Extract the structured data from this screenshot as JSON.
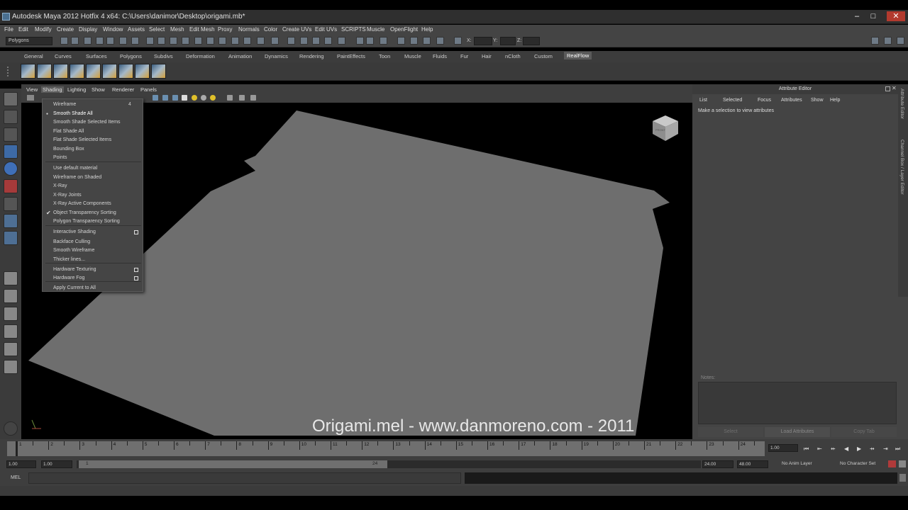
{
  "window": {
    "title": "Autodesk Maya 2012 Hotfix 4 x64: C:\\Users\\danimor\\Desktop\\origami.mb*"
  },
  "menubar": [
    "File",
    "Edit",
    "Modify",
    "Create",
    "Display",
    "Window",
    "Assets",
    "Select",
    "Mesh",
    "Edit Mesh",
    "Proxy",
    "Normals",
    "Color",
    "Create UVs",
    "Edit UVs",
    "SCRIPTS",
    "Muscle",
    "OpenFlight",
    "Help"
  ],
  "statusline": {
    "mode": "Polygons",
    "coord_labels": [
      "X:",
      "Y:",
      "Z:"
    ]
  },
  "shelf_tabs": [
    "General",
    "Curves",
    "Surfaces",
    "Polygons",
    "Subdivs",
    "Deformation",
    "Animation",
    "Dynamics",
    "Rendering",
    "PaintEffects",
    "Toon",
    "Muscle",
    "Fluids",
    "Fur",
    "Hair",
    "nCloth",
    "Custom",
    "RealFlow"
  ],
  "shelf_active": "RealFlow",
  "panel_menu": [
    "View",
    "Shading",
    "Lighting",
    "Show",
    "Renderer",
    "Panels"
  ],
  "shading_menu": {
    "items": [
      "Wireframe",
      "Smooth Shade All",
      "Smooth Shade Selected Items",
      "Flat Shade All",
      "Flat Shade Selected Items",
      "Bounding Box",
      "Points",
      "Use default material",
      "Wireframe on Shaded",
      "X-Ray",
      "X-Ray Joints",
      "X-Ray Active Components",
      "Object Transparency Sorting",
      "Polygon Transparency Sorting",
      "Interactive Shading",
      "Backface Culling",
      "Smooth Wireframe",
      "Thicker lines...",
      "Hardware Texturing",
      "Hardware Fog",
      "Apply Current to All"
    ],
    "wireframe_hotkey": "4",
    "selected_radio": "Smooth Shade All",
    "checked": "Object Transparency Sorting",
    "option_box_items": [
      "Interactive Shading",
      "Hardware Texturing",
      "Hardware Fog"
    ]
  },
  "viewport": {
    "watermark": "Origami.mel - www.danmoreno.com - 2011",
    "viewcube_label": "FRONT"
  },
  "attribute_editor": {
    "title": "Attribute Editor",
    "menu": [
      "List",
      "Selected",
      "Focus",
      "Attributes",
      "Show",
      "Help"
    ],
    "message": "Make a selection to view attributes",
    "notes_label": "Notes:",
    "buttons": [
      "Select",
      "Load Attributes",
      "Copy Tab"
    ]
  },
  "side_tabs": [
    "Attribute Editor",
    "Channel Box / Layer Editor"
  ],
  "timeline": {
    "ticks": [
      "1",
      "2",
      "3",
      "4",
      "5",
      "6",
      "7",
      "8",
      "9",
      "10",
      "11",
      "12",
      "13",
      "14",
      "15",
      "16",
      "17",
      "18",
      "19",
      "20",
      "21",
      "22",
      "23",
      "24"
    ],
    "current_frame": "1.00"
  },
  "range": {
    "start": "1.00",
    "playback_start": "1.00",
    "slider_start": "1",
    "slider_end": "24",
    "playback_end": "24.00",
    "end": "48.00",
    "anim_layer": "No Anim Layer",
    "character_set": "No Character Set"
  },
  "command_line": {
    "label": "MEL"
  }
}
